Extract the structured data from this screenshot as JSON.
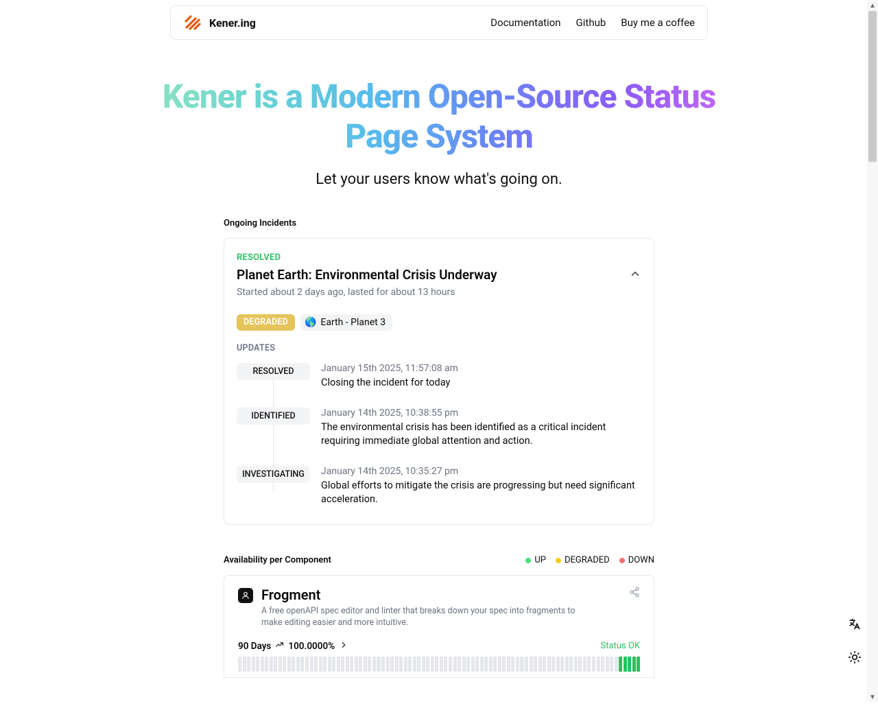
{
  "nav": {
    "brand": "Kener.ing",
    "links": [
      "Documentation",
      "Github",
      "Buy me a coffee"
    ]
  },
  "hero": {
    "title": "Kener is a Modern Open-Source Status Page System",
    "subtitle": "Let your users know what's going on."
  },
  "ongoing": {
    "heading": "Ongoing Incidents",
    "incident": {
      "status": "RESOLVED",
      "title": "Planet Earth: Environmental Crisis Underway",
      "time": "Started about 2 days ago, lasted for about 13 hours",
      "degraded_label": "DEGRADED",
      "planet_emoji": "🌎",
      "planet_label": "Earth - Planet 3",
      "updates_heading": "UPDATES",
      "updates": [
        {
          "state": "RESOLVED",
          "date": "January 15th 2025, 11:57:08 am",
          "msg": "Closing the incident for today"
        },
        {
          "state": "IDENTIFIED",
          "date": "January 14th 2025, 10:38:55 pm",
          "msg": "The environmental crisis has been identified as a critical incident requiring immediate global attention and action."
        },
        {
          "state": "INVESTIGATING",
          "date": "January 14th 2025, 10:35:27 pm",
          "msg": "Global efforts to mitigate the crisis are progressing but need significant acceleration."
        }
      ]
    }
  },
  "availability": {
    "heading": "Availability per Component",
    "legend": {
      "up": "UP",
      "degraded": "DEGRADED",
      "down": "DOWN"
    },
    "component": {
      "name": "Frogment",
      "desc": "A free openAPI spec editor and linter that breaks down your spec into fragments to make editing easier and more intuitive.",
      "range": "90 Days",
      "pct": "100.0000%",
      "status": "Status OK"
    }
  }
}
